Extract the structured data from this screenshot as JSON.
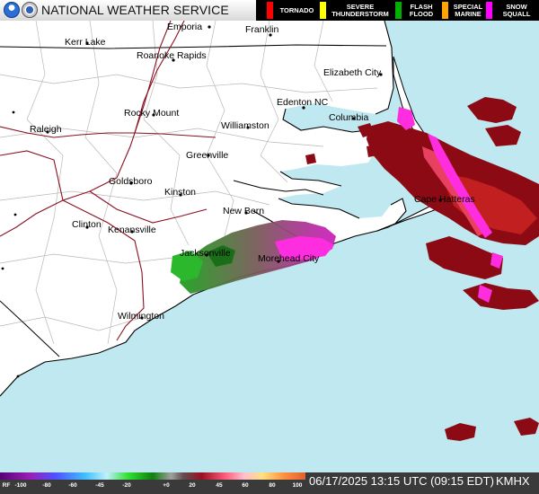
{
  "header": {
    "title": "NATIONAL WEATHER SERVICE",
    "warnings": [
      {
        "label": "TORNADO",
        "color": "#ff0000"
      },
      {
        "label": "SEVERE THUNDERSTORM",
        "color": "#ffff00"
      },
      {
        "label": "FLASH FLOOD",
        "color": "#00b000"
      },
      {
        "label": "SPECIAL MARINE",
        "color": "#ffa500"
      },
      {
        "label": "SNOW SQUALL",
        "color": "#ff00ff"
      }
    ]
  },
  "map": {
    "land_color": "#ffffff",
    "water_color": "#c0e8f0",
    "cities": [
      "Emporia",
      "Franklin",
      "Kerr Lake",
      "Roanoke Rapids",
      "Elizabeth City",
      "Edenton NC",
      "Rocky Mount",
      "Columbia",
      "Raleigh",
      "Williamston",
      "Greenville",
      "Goldsboro",
      "Kinston",
      "Cape Hatteras",
      "New Bern",
      "Clinton",
      "Kenansville",
      "Jacksonville",
      "Morehead City",
      "Wilmington"
    ]
  },
  "footer": {
    "scale_prefix": "RF",
    "scale_ticks": [
      "-100",
      "-80",
      "-60",
      "-45",
      "-20",
      "+0",
      "20",
      "45",
      "60",
      "80",
      "100"
    ],
    "timestamp": "06/17/2025 13:15 UTC (09:15 EDT)",
    "station": "KMHX"
  }
}
